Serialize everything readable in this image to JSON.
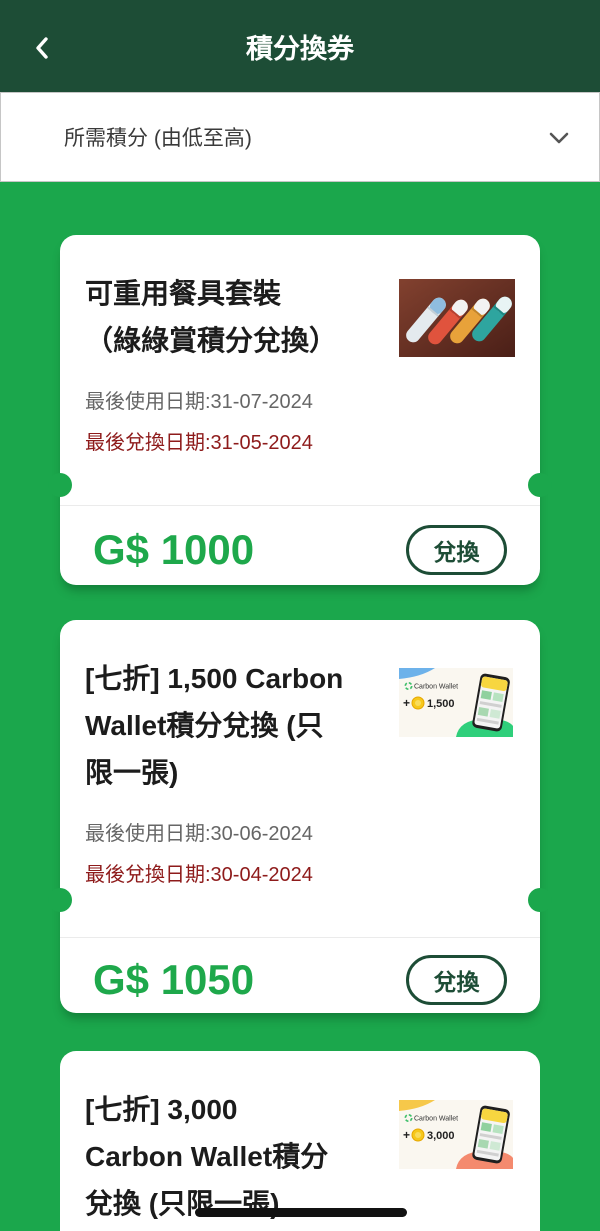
{
  "header": {
    "title": "積分換券",
    "back_icon": "chevron-left-icon"
  },
  "sort": {
    "selected": "所需積分 (由低至高)",
    "icon": "chevron-down-icon"
  },
  "colors": {
    "header_bg": "#1d4d36",
    "page_bg": "#1ba74c",
    "price": "#1ea84b",
    "use_by_text": "#666666",
    "redeem_by_text": "#8e1b1b",
    "button_border": "#1d4d36"
  },
  "coupons": [
    {
      "title_lines": [
        "可重用餐具套裝",
        "（綠綠賞積分兌換）"
      ],
      "use_by": "最後使用日期:31-07-2024",
      "redeem_by": "最後兌換日期:31-05-2024",
      "price": "G$ 1000",
      "button": "兌換"
    },
    {
      "title_lines": [
        "[七折] 1,500 Carbon",
        "Wallet積分兌換 (只",
        "限一張)"
      ],
      "image": {
        "brand": "Carbon Wallet",
        "plus": "+",
        "amount": "1,500"
      },
      "use_by": "最後使用日期:30-06-2024",
      "redeem_by": "最後兌換日期:30-04-2024",
      "price": "G$ 1050",
      "button": "兌換"
    },
    {
      "title_lines": [
        "[七折] 3,000",
        "Carbon Wallet積分",
        "兌換 (只限一張)"
      ],
      "image": {
        "brand": "Carbon Wallet",
        "plus": "+",
        "amount": "3,000"
      }
    }
  ]
}
